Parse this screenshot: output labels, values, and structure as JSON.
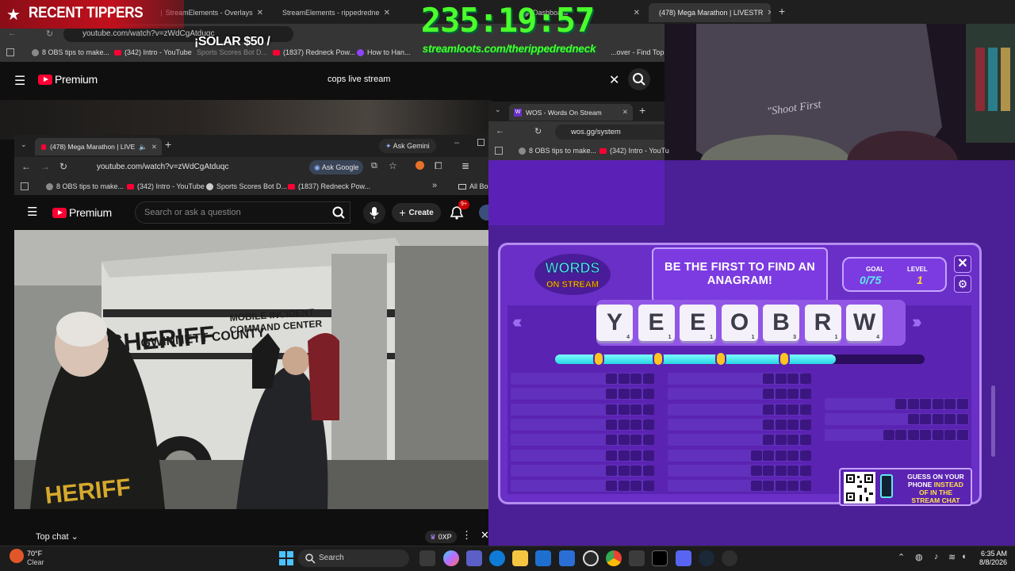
{
  "overlay": {
    "tippers_title": "RECENT TIPPERS",
    "tip_line": "¡SOLAR $50 /",
    "timer": "235:19:57",
    "streamloots_url": "streamloots.com/therippedredneck"
  },
  "back_browser": {
    "tabs": [
      {
        "label": "StreamElements - Overlays"
      },
      {
        "label": "StreamElements - rippedredne"
      },
      {
        "label": "Dashboard"
      },
      {
        "label": "(478) Mega Marathon | LIVESTR"
      }
    ],
    "url": "youtube.com/watch?v=zWdCgAtduqc",
    "bookmarks": [
      {
        "label": "8 OBS tips to make..."
      },
      {
        "label": "(342) Intro - YouTube"
      },
      {
        "label": "Sports Scores Bot D..."
      },
      {
        "label": "(1837) Redneck Pow..."
      },
      {
        "label": "How to Han..."
      },
      {
        "label": "...over - Find Top..."
      }
    ],
    "yt_logo": "Premium",
    "search_value": "cops live stream"
  },
  "front_browser": {
    "tab_label": "(478) Mega Marathon | LIVE",
    "ask_gemini": "Ask Gemini",
    "url": "youtube.com/watch?v=zWdCgAtduqc",
    "ask_google": "Ask Google",
    "bookmarks": [
      {
        "label": "8 OBS tips to make..."
      },
      {
        "label": "(342) Intro - YouTube"
      },
      {
        "label": "Sports Scores Bot D..."
      },
      {
        "label": "(1837) Redneck Pow..."
      }
    ],
    "all_bookmarks": "All Bo",
    "yt_logo": "Premium",
    "search_placeholder": "Search or ask a question",
    "create_label": "Create",
    "notif_count": "9+",
    "video_text": {
      "county": "GWINNETT COUNTY",
      "sheriff": "SHERIFF",
      "mobile1": "MOBILE INCIDENT",
      "mobile2": "COMMAND CENTER",
      "jacket": "HERIFF"
    },
    "top_chat": "Top chat",
    "xp": "0XP"
  },
  "wos_browser": {
    "tab_label": "WOS - Words On Stream",
    "url": "wos.gg/system",
    "bookmarks": [
      {
        "label": "8 OBS tips to make..."
      },
      {
        "label": "(342) Intro - YouTu"
      }
    ]
  },
  "wos_game": {
    "logo_top": "WORDS",
    "logo_bottom": "ON STREAM",
    "banner": "BE THE FIRST TO FIND AN ANAGRAM!",
    "goal_label": "GOAL",
    "goal_value": "0/75",
    "level_label": "LEVEL",
    "level_value": "1",
    "progress_fraction": 0.76,
    "tiles": [
      {
        "letter": "Y",
        "points": "4"
      },
      {
        "letter": "E",
        "points": "1"
      },
      {
        "letter": "E",
        "points": "1"
      },
      {
        "letter": "O",
        "points": "1"
      },
      {
        "letter": "B",
        "points": "3"
      },
      {
        "letter": "R",
        "points": "1"
      },
      {
        "letter": "W",
        "points": "4"
      }
    ],
    "qr_line1": "GUESS ON YOUR",
    "qr_line2a": "PHONE ",
    "qr_line2b": "INSTEAD",
    "qr_line3": "OF IN THE",
    "qr_line4": "STREAM CHAT"
  },
  "taskbar": {
    "temp": "70°F",
    "condition": "Clear",
    "search": "Search",
    "time": "6:35 AM",
    "date": "8/8/2026"
  },
  "colors": {
    "timer_green": "#4bff2b",
    "wos_purple": "#5b23b2",
    "youtube_red": "#ff0033"
  }
}
